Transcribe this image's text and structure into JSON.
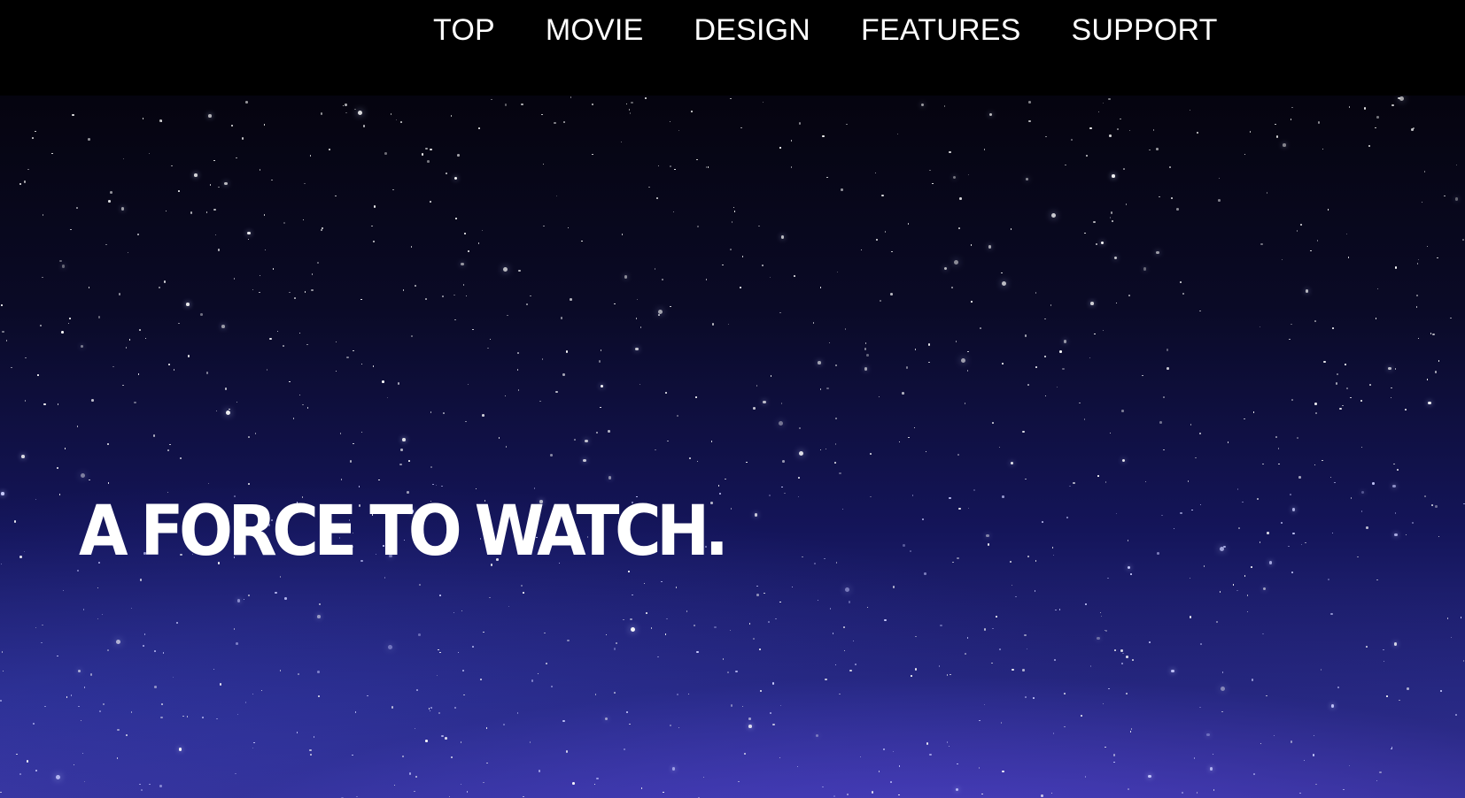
{
  "nav": {
    "items": [
      {
        "label": "TOP"
      },
      {
        "label": "MOVIE"
      },
      {
        "label": "DESIGN"
      },
      {
        "label": "FEATURES"
      },
      {
        "label": "SUPPORT"
      }
    ]
  },
  "hero": {
    "headline": "A FORCE TO WATCH.",
    "background": "starry-night-sky"
  },
  "colors": {
    "nav_background": "#000000",
    "nav_text": "#ffffff",
    "headline_text": "#ffffff",
    "sky_top": "#05040f",
    "sky_bottom": "#3b36a0"
  }
}
